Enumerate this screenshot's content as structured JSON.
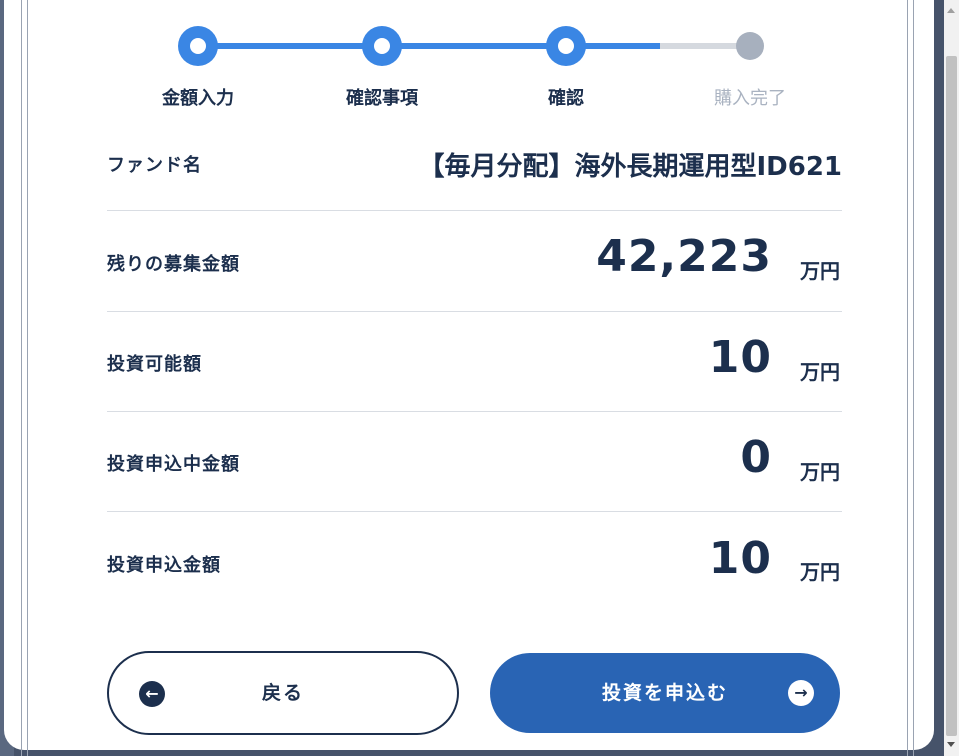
{
  "stepper": {
    "steps": [
      {
        "label": "金額入力",
        "state": "done"
      },
      {
        "label": "確認事項",
        "state": "done"
      },
      {
        "label": "確認",
        "state": "current"
      },
      {
        "label": "購入完了",
        "state": "pending"
      }
    ]
  },
  "details": {
    "fund_name_label": "ファンド名",
    "fund_name_value": "【毎月分配】海外長期運用型ID621",
    "remaining_label": "残りの募集金額",
    "remaining_value": "42,223",
    "investable_label": "投資可能額",
    "investable_value": "10",
    "pending_label": "投資申込中金額",
    "pending_value": "0",
    "apply_label": "投資申込金額",
    "apply_value": "10",
    "unit": "万円"
  },
  "actions": {
    "back_label": "戻る",
    "back_icon": "arrow-left-icon",
    "submit_label": "投資を申込む",
    "submit_icon": "arrow-right-icon"
  },
  "colors": {
    "primary": "#3a86e4",
    "button": "#2964b4",
    "text": "#1c2f4d",
    "inactive": "#a7b0be"
  }
}
